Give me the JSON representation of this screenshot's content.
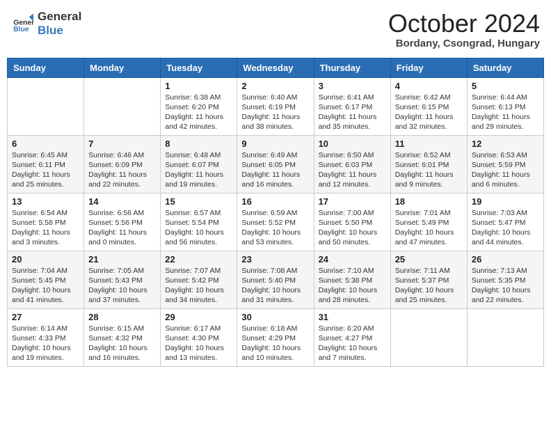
{
  "header": {
    "logo_line1": "General",
    "logo_line2": "Blue",
    "month_title": "October 2024",
    "location": "Bordany, Csongrad, Hungary"
  },
  "days_of_week": [
    "Sunday",
    "Monday",
    "Tuesday",
    "Wednesday",
    "Thursday",
    "Friday",
    "Saturday"
  ],
  "weeks": [
    [
      {
        "day": "",
        "content": ""
      },
      {
        "day": "",
        "content": ""
      },
      {
        "day": "1",
        "sunrise": "6:38 AM",
        "sunset": "6:20 PM",
        "daylight": "11 hours and 42 minutes."
      },
      {
        "day": "2",
        "sunrise": "6:40 AM",
        "sunset": "6:19 PM",
        "daylight": "11 hours and 38 minutes."
      },
      {
        "day": "3",
        "sunrise": "6:41 AM",
        "sunset": "6:17 PM",
        "daylight": "11 hours and 35 minutes."
      },
      {
        "day": "4",
        "sunrise": "6:42 AM",
        "sunset": "6:15 PM",
        "daylight": "11 hours and 32 minutes."
      },
      {
        "day": "5",
        "sunrise": "6:44 AM",
        "sunset": "6:13 PM",
        "daylight": "11 hours and 29 minutes."
      }
    ],
    [
      {
        "day": "6",
        "sunrise": "6:45 AM",
        "sunset": "6:11 PM",
        "daylight": "11 hours and 25 minutes."
      },
      {
        "day": "7",
        "sunrise": "6:46 AM",
        "sunset": "6:09 PM",
        "daylight": "11 hours and 22 minutes."
      },
      {
        "day": "8",
        "sunrise": "6:48 AM",
        "sunset": "6:07 PM",
        "daylight": "11 hours and 19 minutes."
      },
      {
        "day": "9",
        "sunrise": "6:49 AM",
        "sunset": "6:05 PM",
        "daylight": "11 hours and 16 minutes."
      },
      {
        "day": "10",
        "sunrise": "6:50 AM",
        "sunset": "6:03 PM",
        "daylight": "11 hours and 12 minutes."
      },
      {
        "day": "11",
        "sunrise": "6:52 AM",
        "sunset": "6:01 PM",
        "daylight": "11 hours and 9 minutes."
      },
      {
        "day": "12",
        "sunrise": "6:53 AM",
        "sunset": "5:59 PM",
        "daylight": "11 hours and 6 minutes."
      }
    ],
    [
      {
        "day": "13",
        "sunrise": "6:54 AM",
        "sunset": "5:58 PM",
        "daylight": "11 hours and 3 minutes."
      },
      {
        "day": "14",
        "sunrise": "6:56 AM",
        "sunset": "5:56 PM",
        "daylight": "11 hours and 0 minutes."
      },
      {
        "day": "15",
        "sunrise": "6:57 AM",
        "sunset": "5:54 PM",
        "daylight": "10 hours and 56 minutes."
      },
      {
        "day": "16",
        "sunrise": "6:59 AM",
        "sunset": "5:52 PM",
        "daylight": "10 hours and 53 minutes."
      },
      {
        "day": "17",
        "sunrise": "7:00 AM",
        "sunset": "5:50 PM",
        "daylight": "10 hours and 50 minutes."
      },
      {
        "day": "18",
        "sunrise": "7:01 AM",
        "sunset": "5:49 PM",
        "daylight": "10 hours and 47 minutes."
      },
      {
        "day": "19",
        "sunrise": "7:03 AM",
        "sunset": "5:47 PM",
        "daylight": "10 hours and 44 minutes."
      }
    ],
    [
      {
        "day": "20",
        "sunrise": "7:04 AM",
        "sunset": "5:45 PM",
        "daylight": "10 hours and 41 minutes."
      },
      {
        "day": "21",
        "sunrise": "7:05 AM",
        "sunset": "5:43 PM",
        "daylight": "10 hours and 37 minutes."
      },
      {
        "day": "22",
        "sunrise": "7:07 AM",
        "sunset": "5:42 PM",
        "daylight": "10 hours and 34 minutes."
      },
      {
        "day": "23",
        "sunrise": "7:08 AM",
        "sunset": "5:40 PM",
        "daylight": "10 hours and 31 minutes."
      },
      {
        "day": "24",
        "sunrise": "7:10 AM",
        "sunset": "5:38 PM",
        "daylight": "10 hours and 28 minutes."
      },
      {
        "day": "25",
        "sunrise": "7:11 AM",
        "sunset": "5:37 PM",
        "daylight": "10 hours and 25 minutes."
      },
      {
        "day": "26",
        "sunrise": "7:13 AM",
        "sunset": "5:35 PM",
        "daylight": "10 hours and 22 minutes."
      }
    ],
    [
      {
        "day": "27",
        "sunrise": "6:14 AM",
        "sunset": "4:33 PM",
        "daylight": "10 hours and 19 minutes."
      },
      {
        "day": "28",
        "sunrise": "6:15 AM",
        "sunset": "4:32 PM",
        "daylight": "10 hours and 16 minutes."
      },
      {
        "day": "29",
        "sunrise": "6:17 AM",
        "sunset": "4:30 PM",
        "daylight": "10 hours and 13 minutes."
      },
      {
        "day": "30",
        "sunrise": "6:18 AM",
        "sunset": "4:29 PM",
        "daylight": "10 hours and 10 minutes."
      },
      {
        "day": "31",
        "sunrise": "6:20 AM",
        "sunset": "4:27 PM",
        "daylight": "10 hours and 7 minutes."
      },
      {
        "day": "",
        "content": ""
      },
      {
        "day": "",
        "content": ""
      }
    ]
  ]
}
